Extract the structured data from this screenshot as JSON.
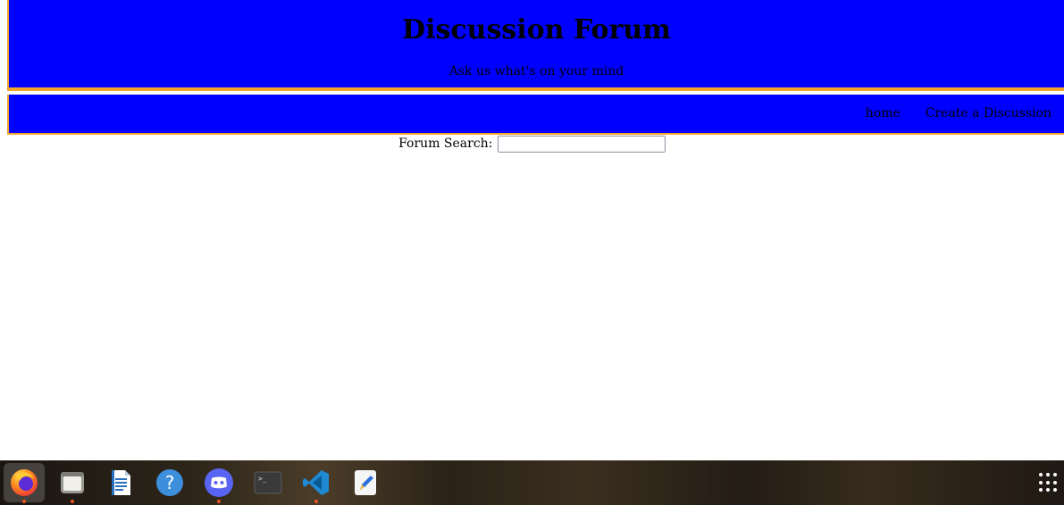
{
  "header": {
    "title": "Discussion Forum",
    "subtitle": "Ask us what's on your mind"
  },
  "nav": {
    "home_label": "home",
    "create_label": "Create a Discussion"
  },
  "search": {
    "label": "Forum Search:",
    "value": ""
  },
  "colors": {
    "header_bg": "#0000ff",
    "border_accent": "#f3a52a"
  },
  "taskbar": {
    "apps": [
      {
        "icon": "firefox-icon",
        "running": true,
        "active": true
      },
      {
        "icon": "files-icon",
        "running": true,
        "active": false
      },
      {
        "icon": "writer-icon",
        "running": false,
        "active": false
      },
      {
        "icon": "help-icon",
        "running": false,
        "active": false
      },
      {
        "icon": "discord-icon",
        "running": true,
        "active": false
      },
      {
        "icon": "terminal-icon",
        "running": false,
        "active": false
      },
      {
        "icon": "vscode-icon",
        "running": true,
        "active": false
      },
      {
        "icon": "text-editor-icon",
        "running": false,
        "active": false
      }
    ],
    "show_apps_icon": "app-grid-icon"
  }
}
